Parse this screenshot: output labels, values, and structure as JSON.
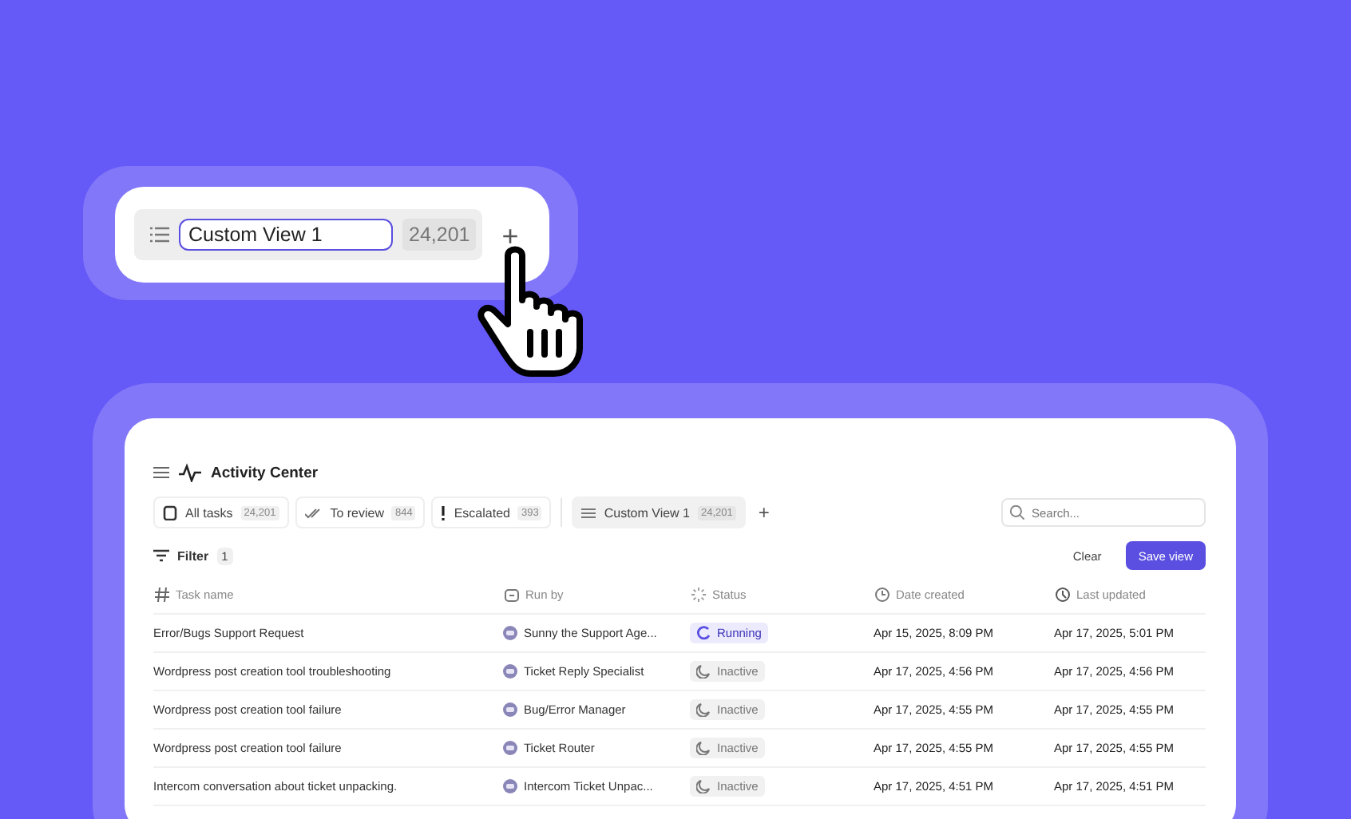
{
  "rename_card": {
    "value": "Custom View 1",
    "count": "24,201",
    "add": "+"
  },
  "panel": {
    "title": "Activity Center",
    "tabs": [
      {
        "label": "All tasks",
        "count": "24,201",
        "selected": false
      },
      {
        "label": "To review",
        "count": "844",
        "selected": false
      },
      {
        "label": "Escalated",
        "count": "393",
        "selected": false
      },
      {
        "label": "Custom View 1",
        "count": "24,201",
        "selected": true
      }
    ],
    "add": "+",
    "search": {
      "placeholder": "Search..."
    },
    "filter": {
      "label": "Filter",
      "count": "1"
    },
    "clear": "Clear",
    "save": "Save view",
    "columns": [
      "Task name",
      "Run by",
      "Status",
      "Date created",
      "Last updated"
    ],
    "rows": [
      {
        "task": "Error/Bugs Support Request",
        "run_by": "Sunny the Support Age...",
        "status": {
          "kind": "running",
          "label": "Running"
        },
        "created": "Apr 15, 2025, 8:09 PM",
        "updated": "Apr 17, 2025, 5:01 PM"
      },
      {
        "task": "Wordpress post creation tool troubleshooting",
        "run_by": "Ticket Reply Specialist",
        "status": {
          "kind": "inactive",
          "label": "Inactive"
        },
        "created": "Apr 17, 2025, 4:56 PM",
        "updated": "Apr 17, 2025, 4:56 PM"
      },
      {
        "task": "Wordpress post creation tool failure",
        "run_by": "Bug/Error Manager",
        "status": {
          "kind": "inactive",
          "label": "Inactive"
        },
        "created": "Apr 17, 2025, 4:55 PM",
        "updated": "Apr 17, 2025, 4:55 PM"
      },
      {
        "task": "Wordpress post creation tool failure",
        "run_by": "Ticket Router",
        "status": {
          "kind": "inactive",
          "label": "Inactive"
        },
        "created": "Apr 17, 2025, 4:55 PM",
        "updated": "Apr 17, 2025, 4:55 PM"
      },
      {
        "task": "Intercom conversation about ticket unpacking.",
        "run_by": "Intercom Ticket Unpac...",
        "status": {
          "kind": "inactive",
          "label": "Inactive"
        },
        "created": "Apr 17, 2025, 4:51 PM",
        "updated": "Apr 17, 2025, 4:51 PM"
      }
    ]
  }
}
